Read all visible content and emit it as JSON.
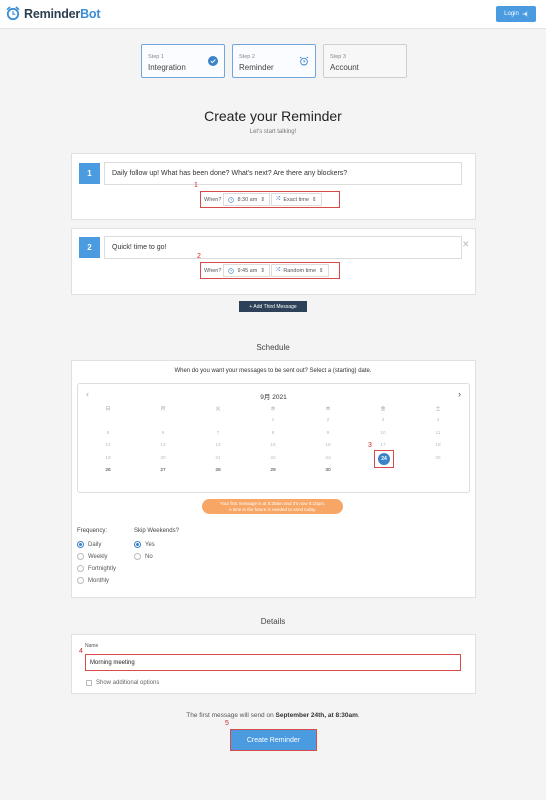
{
  "header": {
    "logo_main": "Reminder",
    "logo_accent": "Bot",
    "login_label": "Login"
  },
  "steps": [
    {
      "num": "Step 1",
      "title": "Integration",
      "icon": "check-icon"
    },
    {
      "num": "Step 2",
      "title": "Reminder",
      "icon": "alarm-clock-icon"
    },
    {
      "num": "Step 3",
      "title": "Account",
      "icon": ""
    }
  ],
  "page": {
    "title": "Create your Reminder",
    "subtitle": "Let's start talking!"
  },
  "messages": [
    {
      "num": "1",
      "text": "Daily follow up! What has been done? What's next? Are there any blockers?",
      "when_label": "When?",
      "time": "8:30 am",
      "mode": "Exact time",
      "marker": "1"
    },
    {
      "num": "2",
      "text": "Quick! time to go!",
      "when_label": "When?",
      "time": "9:45 am",
      "mode": "Random time",
      "marker": "2"
    }
  ],
  "add_message_label": "+ Add Third Message",
  "schedule": {
    "section_title": "Schedule",
    "question": "When do you want your messages to be sent out? Select a (starting) date.",
    "calendar": {
      "month_label": "9月 2021",
      "weekdays": [
        "日",
        "月",
        "火",
        "水",
        "木",
        "金",
        "土"
      ],
      "weeks": [
        [
          "",
          "",
          "",
          "1",
          "2",
          "3",
          "4"
        ],
        [
          "5",
          "6",
          "7",
          "8",
          "9",
          "10",
          "11"
        ],
        [
          "12",
          "13",
          "14",
          "15",
          "16",
          "17",
          "18"
        ],
        [
          "19",
          "20",
          "21",
          "22",
          "23",
          "",
          "25"
        ],
        [
          "26",
          "27",
          "28",
          "29",
          "30",
          "",
          ""
        ]
      ],
      "selected_day": "24",
      "selected_marker": "3"
    },
    "notice_line1": "Your first message is at 8:30am and it's now 5:10pm.",
    "notice_line2": "A time in the future is needed to send today.",
    "frequency_label": "Frequency:",
    "frequency_options": [
      "Daily",
      "Weekly",
      "Fortnightly",
      "Monthly"
    ],
    "frequency_selected": "Daily",
    "skip_label": "Skip Weekends?",
    "skip_options": [
      "Yes",
      "No"
    ],
    "skip_selected": "Yes"
  },
  "details": {
    "section_title": "Details",
    "name_label": "Name",
    "name_value": "Morning meeting",
    "name_marker": "4",
    "show_options_label": "Show additional options"
  },
  "summary": {
    "prefix": "The first message will send on ",
    "date": "September 24th, at 8:30am",
    "suffix": "."
  },
  "create_button": {
    "label": "Create Reminder",
    "marker": "5"
  }
}
